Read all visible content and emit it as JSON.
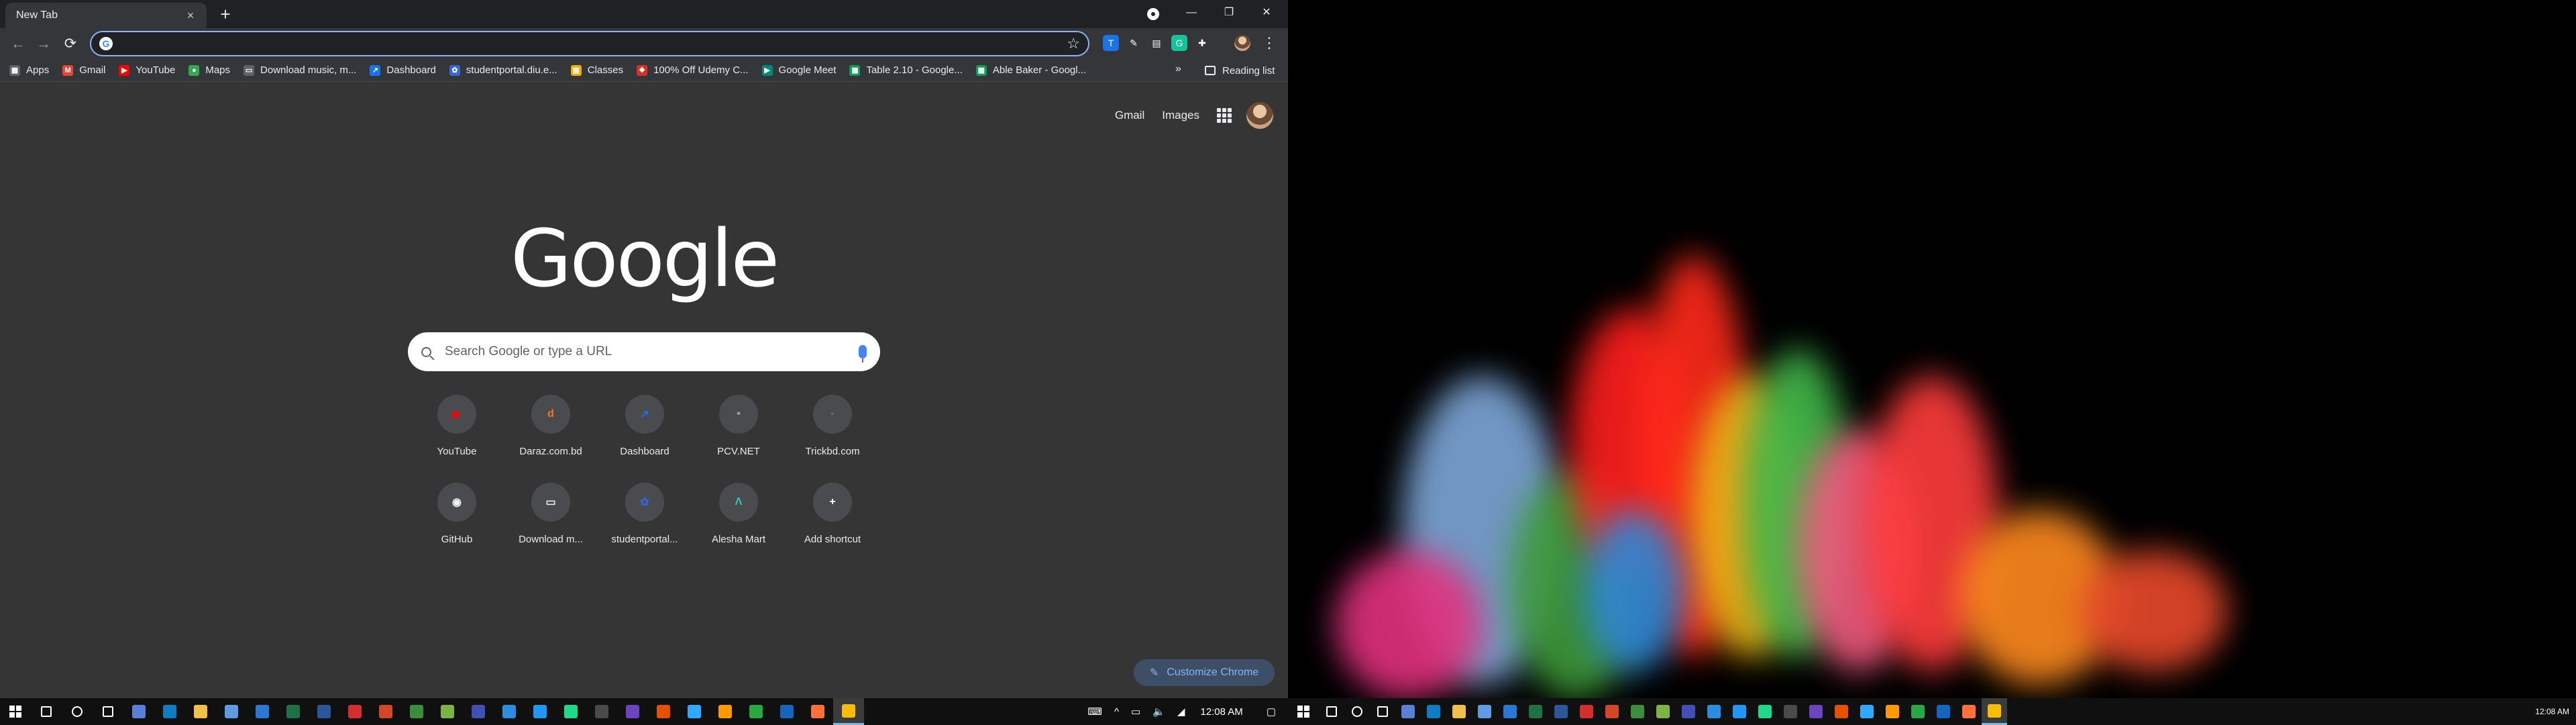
{
  "browser": {
    "tab_title": "New Tab",
    "tab_close": "×",
    "new_tab": "+",
    "window_controls": {
      "minimize": "—",
      "maximize": "❐",
      "close": "✕"
    },
    "nav": {
      "back": "←",
      "forward": "→",
      "reload": "⟳"
    },
    "omnibox": {
      "value": "",
      "placeholder": ""
    },
    "star": "☆",
    "menu": "⋮",
    "extensions": [
      {
        "name": "translate-ext-icon",
        "color": "#1a73e8",
        "glyph": "T"
      },
      {
        "name": "eyedropper-ext-icon",
        "color": "#35363a",
        "glyph": "✎"
      },
      {
        "name": "notes-ext-icon",
        "color": "#35363a",
        "glyph": "▤"
      },
      {
        "name": "grammarly-ext-icon",
        "color": "#15c39a",
        "glyph": "G"
      },
      {
        "name": "puzzle-ext-icon",
        "color": "#35363a",
        "glyph": "✚"
      }
    ]
  },
  "bookmarks": {
    "items": [
      {
        "label": "Apps",
        "icon": "apps-icon",
        "color": "#5f6368",
        "glyph": "▦"
      },
      {
        "label": "Gmail",
        "icon": "gmail-icon",
        "color": "#ea4335",
        "glyph": "M"
      },
      {
        "label": "YouTube",
        "icon": "youtube-icon",
        "color": "#ff0000",
        "glyph": "▶"
      },
      {
        "label": "Maps",
        "icon": "maps-icon",
        "color": "#34a853",
        "glyph": "●"
      },
      {
        "label": "Download music, m...",
        "icon": "monitor-icon",
        "color": "#5f6368",
        "glyph": "▭"
      },
      {
        "label": "Dashboard",
        "icon": "dashboard-icon",
        "color": "#1a73e8",
        "glyph": "↗"
      },
      {
        "label": "studentportal.diu.e...",
        "icon": "diu-icon",
        "color": "#3367d6",
        "glyph": "✿"
      },
      {
        "label": "Classes",
        "icon": "classroom-icon",
        "color": "#f9ab00",
        "glyph": "▣"
      },
      {
        "label": "100% Off Udemy C...",
        "icon": "udemy-icon",
        "color": "#d93025",
        "glyph": "❖"
      },
      {
        "label": "Google Meet",
        "icon": "meet-icon",
        "color": "#00897b",
        "glyph": "▶"
      },
      {
        "label": "Table 2.10 - Google...",
        "icon": "sheets-icon",
        "color": "#0f9d58",
        "glyph": "▦"
      },
      {
        "label": "Able Baker - Googl...",
        "icon": "sheets-icon",
        "color": "#0f9d58",
        "glyph": "▦"
      }
    ],
    "more": "»",
    "reading_list": "Reading list"
  },
  "ntp": {
    "gmail_link": "Gmail",
    "images_link": "Images",
    "logo": "Google",
    "search_placeholder": "Search Google or type a URL",
    "shortcuts": [
      {
        "label": "YouTube",
        "glyph": "▶",
        "color": "#ff0000",
        "icon": "youtube-icon"
      },
      {
        "label": "Daraz.com.bd",
        "glyph": "d",
        "color": "#f57224",
        "icon": "daraz-icon"
      },
      {
        "label": "Dashboard",
        "glyph": "↗",
        "color": "#1a73e8",
        "icon": "dashboard-icon"
      },
      {
        "label": "PCV.NET",
        "glyph": "•",
        "color": "#9aa0a6",
        "icon": "pcv-icon"
      },
      {
        "label": "Trickbd.com",
        "glyph": "▪",
        "color": "#5f6368",
        "icon": "trickbd-icon"
      },
      {
        "label": "GitHub",
        "glyph": "◉",
        "color": "#ffffff",
        "icon": "github-icon"
      },
      {
        "label": "Download m...",
        "glyph": "▭",
        "color": "#e8eaed",
        "icon": "monitor-icon"
      },
      {
        "label": "studentportal...",
        "glyph": "✿",
        "color": "#3367d6",
        "icon": "diu-icon"
      },
      {
        "label": "Alesha Mart",
        "glyph": "Λ",
        "color": "#36c2b4",
        "icon": "alesha-icon"
      },
      {
        "label": "Add shortcut",
        "glyph": "+",
        "color": "#ffffff",
        "icon": "plus-icon"
      }
    ],
    "customize": "Customize Chrome"
  },
  "taskbar_left": {
    "clock": "12:08 AM",
    "apps": [
      {
        "name": "search-icon",
        "color": "transparent"
      },
      {
        "name": "cortana-icon",
        "color": "transparent"
      },
      {
        "name": "task-view-icon",
        "color": "transparent"
      },
      {
        "name": "snip-icon",
        "color": "#5a7fd6"
      },
      {
        "name": "edge-icon",
        "color": "#0f7dc2"
      },
      {
        "name": "file-explorer-icon",
        "color": "#f2c04a"
      },
      {
        "name": "store-icon",
        "color": "#5e9be3"
      },
      {
        "name": "mail-icon",
        "color": "#2b78d4"
      },
      {
        "name": "excel-icon",
        "color": "#1e7145"
      },
      {
        "name": "word-icon",
        "color": "#2b579a"
      },
      {
        "name": "acrobat-icon",
        "color": "#d32f2f"
      },
      {
        "name": "powerpoint-icon",
        "color": "#d24726"
      },
      {
        "name": "idm-icon",
        "color": "#3c8d3c"
      },
      {
        "name": "chrome-canary-icon",
        "color": "#7cb342"
      },
      {
        "name": "camera-icon",
        "color": "#3f51b5"
      },
      {
        "name": "vscode-icon",
        "color": "#2b8de0"
      },
      {
        "name": "media-icon",
        "color": "#2196f3"
      },
      {
        "name": "pycharm-icon",
        "color": "#21d789"
      },
      {
        "name": "terminal-icon",
        "color": "#4a4a4a"
      },
      {
        "name": "obs-icon",
        "color": "#6a45bd"
      },
      {
        "name": "calendar-icon",
        "color": "#e65100"
      },
      {
        "name": "photoshop-icon",
        "color": "#31a8ff"
      },
      {
        "name": "illustrator-icon",
        "color": "#ff9a00"
      },
      {
        "name": "gallery-icon",
        "color": "#28a745"
      },
      {
        "name": "remote-icon",
        "color": "#1565c0"
      },
      {
        "name": "firefox-icon",
        "color": "#ff7139"
      },
      {
        "name": "chrome-icon",
        "color": "#fbbc04"
      }
    ]
  },
  "taskbar_right": {
    "clock": "12:08 AM"
  }
}
